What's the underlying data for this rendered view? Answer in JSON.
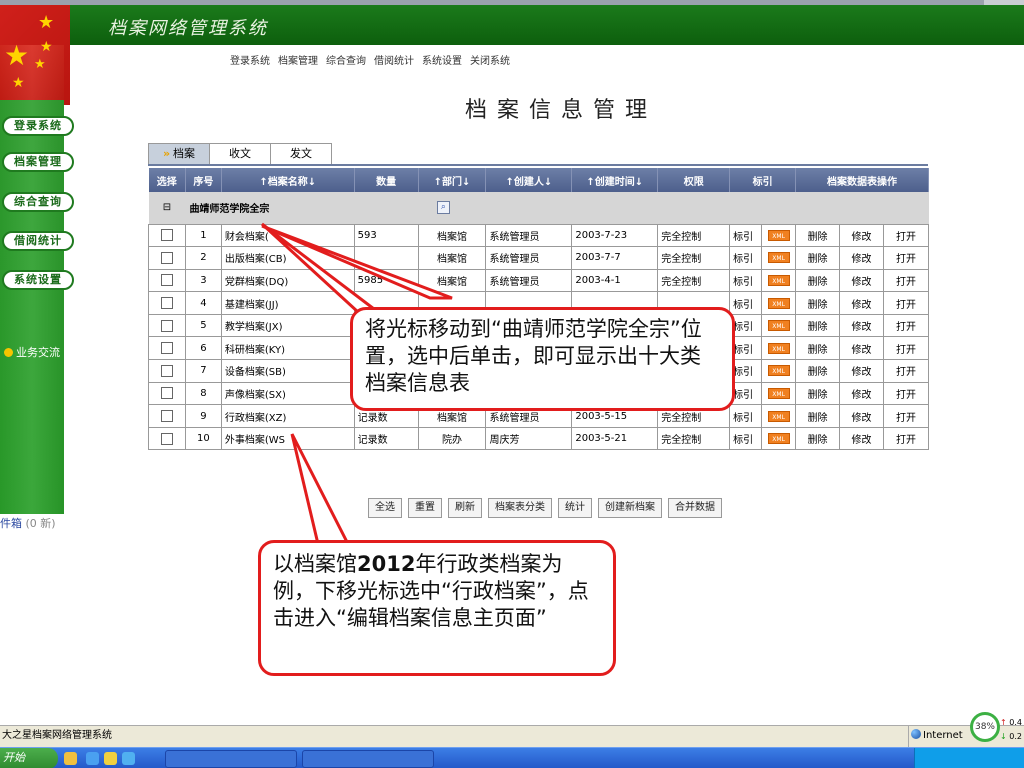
{
  "app_title": "档案网络管理系统",
  "top_menu": [
    "登录系统",
    "档案管理",
    "综合查询",
    "借阅统计",
    "系统设置",
    "关闭系统"
  ],
  "side_nav": [
    "登录系统",
    "档案管理",
    "综合查询",
    "借阅统计",
    "系统设置"
  ],
  "side_extra": "业务交流",
  "mailbox": {
    "label": "件箱",
    "count": "(0 新)"
  },
  "page_title": "档案信息管理",
  "tabs": [
    "档案",
    "收文",
    "发文"
  ],
  "table": {
    "headers": [
      "选择",
      "序号",
      "↑档案名称↓",
      "数量",
      "↑部门↓",
      "↑创建人↓",
      "↑创建时间↓",
      "权限",
      "标引",
      "档案数据表操作"
    ],
    "group_toggle": "⊟",
    "group_name": "曲靖师范学院全宗",
    "rows": [
      {
        "no": "1",
        "name": "财会档案(",
        "qty": "593",
        "dept": "档案馆",
        "creator": "系统管理员",
        "date": "2003-7-23",
        "perm": "完全控制"
      },
      {
        "no": "2",
        "name": "出版档案(CB)",
        "qty": "",
        "dept": "档案馆",
        "creator": "系统管理员",
        "date": "2003-7-7",
        "perm": "完全控制"
      },
      {
        "no": "3",
        "name": "党群档案(DQ)",
        "qty": "5985",
        "dept": "档案馆",
        "creator": "系统管理员",
        "date": "2003-4-1",
        "perm": "完全控制"
      },
      {
        "no": "4",
        "name": "基建档案(JJ)",
        "qty": "",
        "dept": "",
        "creator": "",
        "date": "",
        "perm": ""
      },
      {
        "no": "5",
        "name": "教学档案(JX)",
        "qty": "",
        "dept": "",
        "creator": "",
        "date": "",
        "perm": ""
      },
      {
        "no": "6",
        "name": "科研档案(KY)",
        "qty": "",
        "dept": "",
        "creator": "",
        "date": "",
        "perm": ""
      },
      {
        "no": "7",
        "name": "设备档案(SB)",
        "qty": "",
        "dept": "",
        "creator": "",
        "date": "",
        "perm": ""
      },
      {
        "no": "8",
        "name": "声像档案(SX)",
        "qty": "",
        "dept": "",
        "creator": "",
        "date": "",
        "perm": ""
      },
      {
        "no": "9",
        "name": "行政档案(XZ)",
        "qty": "记录数",
        "dept": "档案馆",
        "creator": "系统管理员",
        "date": "2003-5-15",
        "perm": "完全控制"
      },
      {
        "no": "10",
        "name": "外事档案(WS",
        "qty": "记录数",
        "dept": "院办",
        "creator": "周庆芳",
        "date": "2003-5-21",
        "perm": "完全控制"
      }
    ],
    "index_label": "标引",
    "xml_label": "XML",
    "ops": [
      "删除",
      "修改",
      "打开"
    ]
  },
  "buttons": [
    "全选",
    "重置",
    "刷新",
    "档案表分类",
    "统计",
    "创建新档案",
    "合并数据"
  ],
  "callouts": {
    "top": "将光标移动到“曲靖师范学院全宗”位置，选中后单击，即可显示出十大类档案信息表",
    "bottom_prefix": "以档案馆",
    "bottom_year": "2012",
    "bottom_suffix": "年行政类档案为例，下移光标选中“行政档案”，点击进入“编辑档案信息主页面”"
  },
  "status": {
    "left": "大之星档案网络管理系统",
    "zone": "Internet",
    "gauge": "38%",
    "up": "0.4",
    "down": "0.2"
  },
  "taskbar": {
    "start": "开始"
  },
  "colors": {
    "header_green": "#1b7a1b",
    "header_red": "#d0201b",
    "table_header": "#5a6b96",
    "callout_border": "#e21d1d",
    "xml_orange": "#f08020"
  }
}
